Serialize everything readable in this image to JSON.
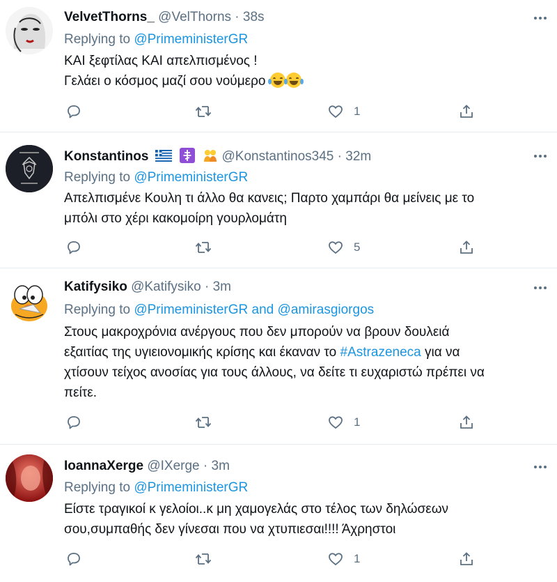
{
  "tweets": [
    {
      "name": "VelvetThorns_",
      "handle": "@VelThorns",
      "separator": "·",
      "time": "38s",
      "reply_prefix": "Replying to",
      "mention1": "@PrimeministerGR",
      "lines": [
        "ΚΑΙ ξεφτίλας ΚΑΙ απελπισμένος !",
        "Γελάει ο κόσμος μαζί σου νούμερο"
      ],
      "likes": "1"
    },
    {
      "name": "Konstantinos",
      "handle": "@Konstantinos345",
      "separator": "·",
      "time": "32m",
      "reply_prefix": "Replying to",
      "mention1": "@PrimeministerGR",
      "lines": [
        "Απελπισμένε Κουλη τι άλλο θα κανεις; Παρτο χαμπάρι θα μείνεις με το",
        "μπόλι στο χέρι κακομοίρη γουρλομάτη"
      ],
      "likes": "5"
    },
    {
      "name": "Katifysiko",
      "handle": "@Katifysiko",
      "separator": "·",
      "time": "3m",
      "reply_prefix": "Replying to",
      "mention1": "@PrimeministerGR",
      "mention_join": "and",
      "mention2": "@amirasgiorgos",
      "lines": [
        "Στους μακροχρόνια ανέργους που δεν μπορούν να βρουν δουλειά",
        "εξαιτίας της υγιειονομικής κρίσης και έκαναν το",
        "χτίσουν τείχος ανοσίας για τους άλλους, να δείτε τι ευχαριστώ πρέπει να",
        "πείτε."
      ],
      "hashtag": "#Astrazeneca",
      "after_hashtag": "για να",
      "likes": "1"
    },
    {
      "name": "IoannaXerge",
      "handle": "@IXerge",
      "separator": "·",
      "time": "3m",
      "reply_prefix": "Replying to",
      "mention1": "@PrimeministerGR",
      "lines": [
        "Είστε τραγικοί κ γελοίοι..κ μη χαμογελάς στο τέλος των δηλώσεων",
        "σου,συμπαθής δεν γίνεσαι που να χτυπιεσαι!!!! Άχρηστοι"
      ],
      "likes": "1"
    }
  ],
  "icons": {
    "reply": "reply-icon",
    "retweet": "retweet-icon",
    "like": "like-icon",
    "share": "share-icon",
    "more": "more-icon"
  },
  "colors": {
    "mention": "#1b95e0",
    "muted": "#5b7083",
    "divider": "#e6ecf0"
  }
}
